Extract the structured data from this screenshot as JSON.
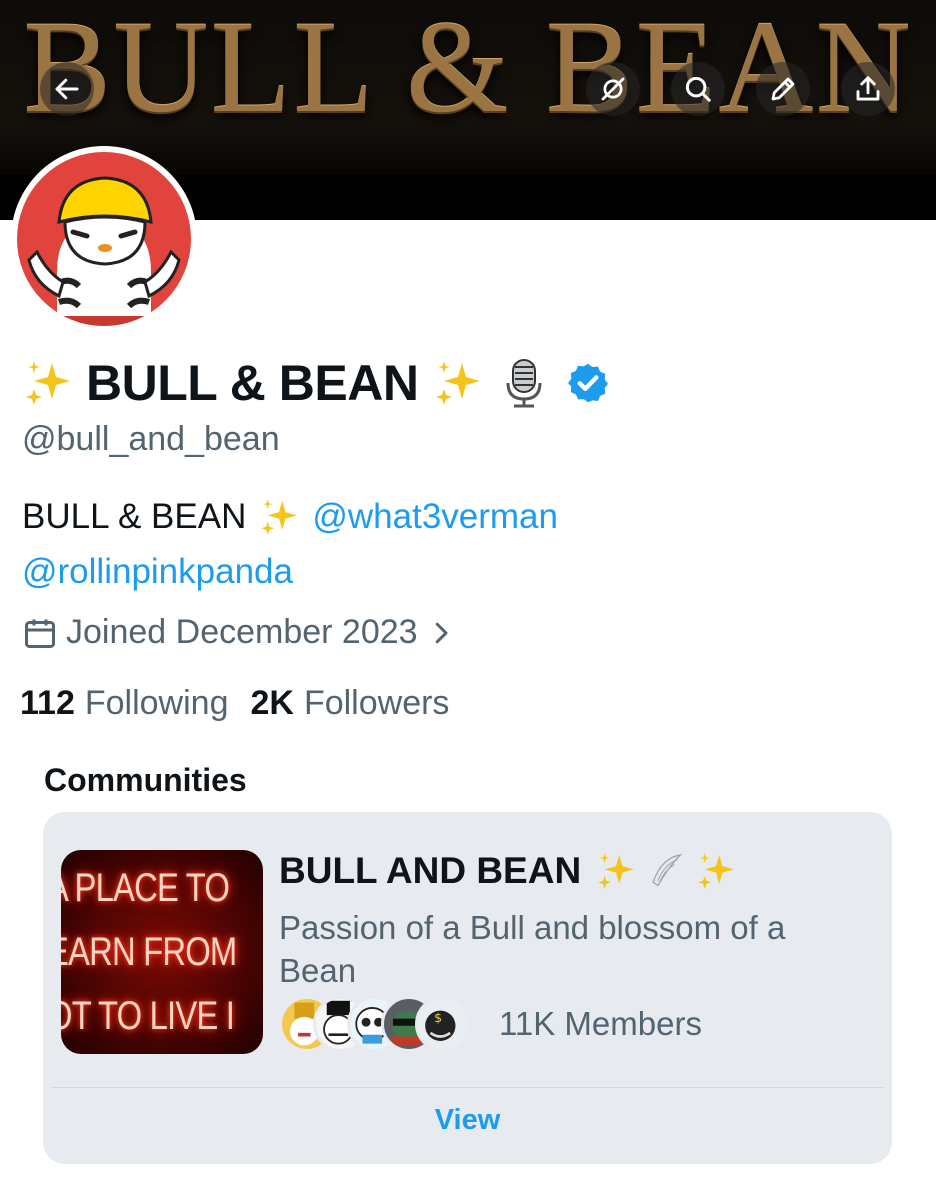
{
  "banner": {
    "text": "BULL & BEAN"
  },
  "nav": {
    "back": "back-arrow-icon",
    "grok": "grok-icon",
    "search": "search-icon",
    "edit": "edit-pencil-icon",
    "share": "share-icon"
  },
  "profile": {
    "name": "BULL & BEAN",
    "handle": "@bull_and_bean",
    "verified_color": "#1d9bf0",
    "bio_prefix": "BULL & BEAN",
    "bio_mention_1": "@what3verman",
    "bio_mention_2": "@rollinpinkpanda",
    "joined": "Joined December 2023",
    "following_count": "112",
    "following_label": "Following",
    "followers_count": "2K",
    "followers_label": "Followers"
  },
  "communities": {
    "heading": "Communities",
    "card": {
      "thumb_lines": [
        "A PLACE TO",
        "EARN FROM",
        "OT TO LIVE I"
      ],
      "title": "BULL AND BEAN",
      "description": "Passion of a Bull and blossom of a Bean",
      "members": "11K Members",
      "view_label": "View"
    }
  },
  "colors": {
    "accent": "#1d9bf0",
    "secondary_text": "#536471",
    "card_bg": "#e7ebf0"
  }
}
